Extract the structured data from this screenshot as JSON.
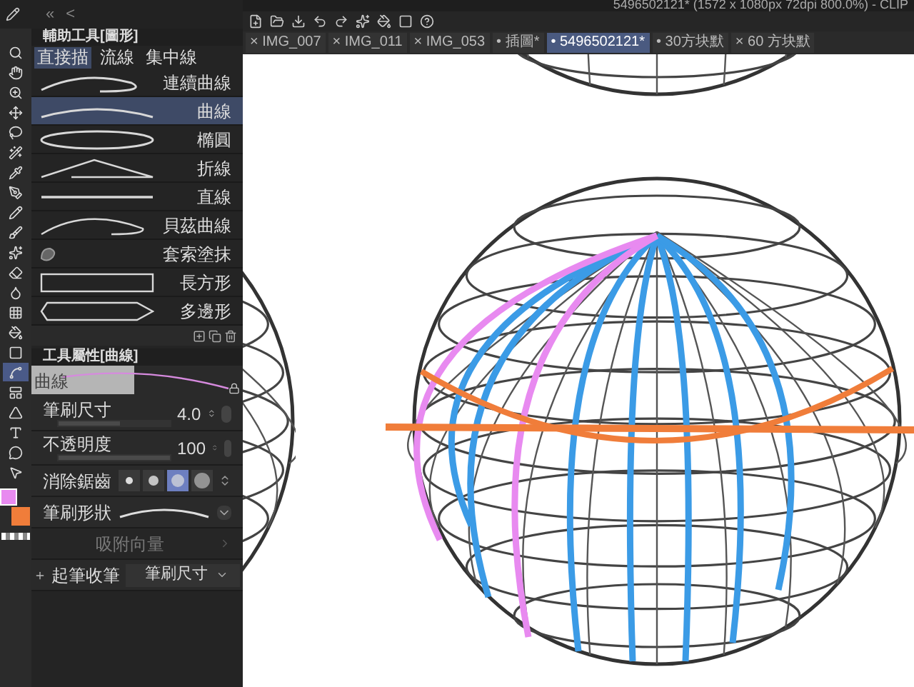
{
  "window": {
    "title": "5496502121* (1572 x 1080px 72dpi 800.0%) - CLIP"
  },
  "panel_nav": {
    "collapse": "«",
    "back": "<"
  },
  "tools": [
    {
      "selected": false
    },
    {
      "selected": false
    },
    {
      "selected": false
    },
    {
      "selected": false
    },
    {
      "selected": false
    },
    {
      "selected": false
    },
    {
      "selected": false
    },
    {
      "selected": false
    },
    {
      "selected": false
    },
    {
      "selected": false
    },
    {
      "selected": false
    },
    {
      "selected": false
    },
    {
      "selected": false
    },
    {
      "selected": false
    },
    {
      "selected": false
    },
    {
      "selected": false
    },
    {
      "selected": true
    },
    {
      "selected": false
    },
    {
      "selected": false
    },
    {
      "selected": false
    },
    {
      "selected": false
    },
    {
      "selected": false
    }
  ],
  "doc_tabs": [
    {
      "mark": "×",
      "label": "IMG_007",
      "selected": false
    },
    {
      "mark": "×",
      "label": "IMG_011",
      "selected": false
    },
    {
      "mark": "×",
      "label": "IMG_053",
      "selected": false
    },
    {
      "mark": "•",
      "label": "插圖*",
      "selected": false
    },
    {
      "mark": "•",
      "label": "5496502121*",
      "selected": true
    },
    {
      "mark": "•",
      "label": "30方块默",
      "selected": false
    },
    {
      "mark": "×",
      "label": "60 方块默",
      "selected": false
    }
  ],
  "sub_tool_panel": {
    "title": "輔助工具[圖形]",
    "groups": [
      {
        "label": "直接描",
        "selected": true
      },
      {
        "label": "流線",
        "selected": false
      },
      {
        "label": "集中線",
        "selected": false
      }
    ],
    "items": [
      {
        "kind": "curve_multi",
        "label": "連續曲線",
        "selected": false
      },
      {
        "kind": "curve",
        "label": "曲線",
        "selected": true
      },
      {
        "kind": "ellipse",
        "label": "橢圓",
        "selected": false
      },
      {
        "kind": "polyline",
        "label": "折線",
        "selected": false
      },
      {
        "kind": "line",
        "label": "直線",
        "selected": false
      },
      {
        "kind": "bezier",
        "label": "貝茲曲線",
        "selected": false
      },
      {
        "kind": "lasso",
        "label": "套索塗抹",
        "selected": false
      },
      {
        "kind": "rect",
        "label": "長方形",
        "selected": false
      },
      {
        "kind": "polygon",
        "label": "多邊形",
        "selected": false
      }
    ]
  },
  "tool_property": {
    "title": "工具屬性[曲線]",
    "preview_label": "曲線",
    "properties": [
      {
        "kind": "slider",
        "label": "筆刷尺寸",
        "value": "4.0",
        "level": 0.55
      },
      {
        "kind": "slider",
        "label": "不透明度",
        "value": "100",
        "level": 1
      },
      {
        "kind": "antialias",
        "label": "消除鋸齒",
        "options": [
          {
            "selected": false
          },
          {
            "selected": false
          },
          {
            "selected": true
          },
          {
            "selected": false
          }
        ]
      },
      {
        "kind": "brush_shape",
        "label": "筆刷形狀"
      },
      {
        "kind": "checkbox",
        "label": "吸附向量",
        "disabled": true
      },
      {
        "kind": "dropdown",
        "label": "起筆收筆",
        "value": "筆刷尺寸"
      }
    ]
  }
}
